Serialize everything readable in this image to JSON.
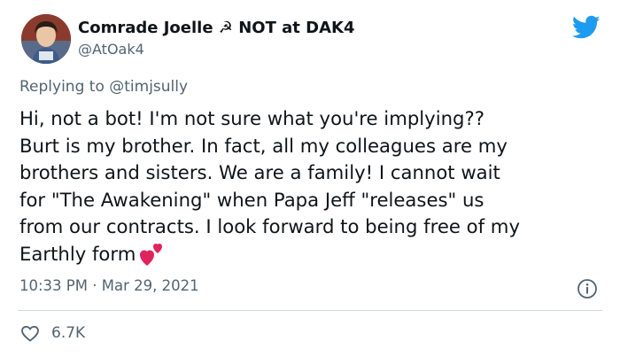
{
  "tweet": {
    "display_name": "Comrade Joelle ☭ NOT at DAK4",
    "handle": "@AtOak4",
    "replying_to_prefix": "Replying to",
    "replying_to_user": "@timjsully",
    "text_lines": [
      "Hi, not a bot! I'm not sure what you're implying??",
      "Burt is my brother. In fact, all my colleagues are my",
      "brothers and sisters. We are a family! I cannot wait",
      "for \"The Awakening\" when Papa Jeff \"releases\" us",
      "from our contracts. I look forward to being free of my",
      "Earthly form"
    ],
    "time": "10:33 PM",
    "separator": "·",
    "date": "Mar 29, 2021",
    "like_count": "6.7K"
  },
  "icons": {
    "brand": "twitter-bird-icon",
    "emoji": "two-hearts-icon",
    "info": "info-icon",
    "like": "heart-outline-icon"
  },
  "colors": {
    "twitter_blue": "#1d9bf0",
    "secondary_text": "#536471",
    "heart_emoji": "#e0245e"
  }
}
